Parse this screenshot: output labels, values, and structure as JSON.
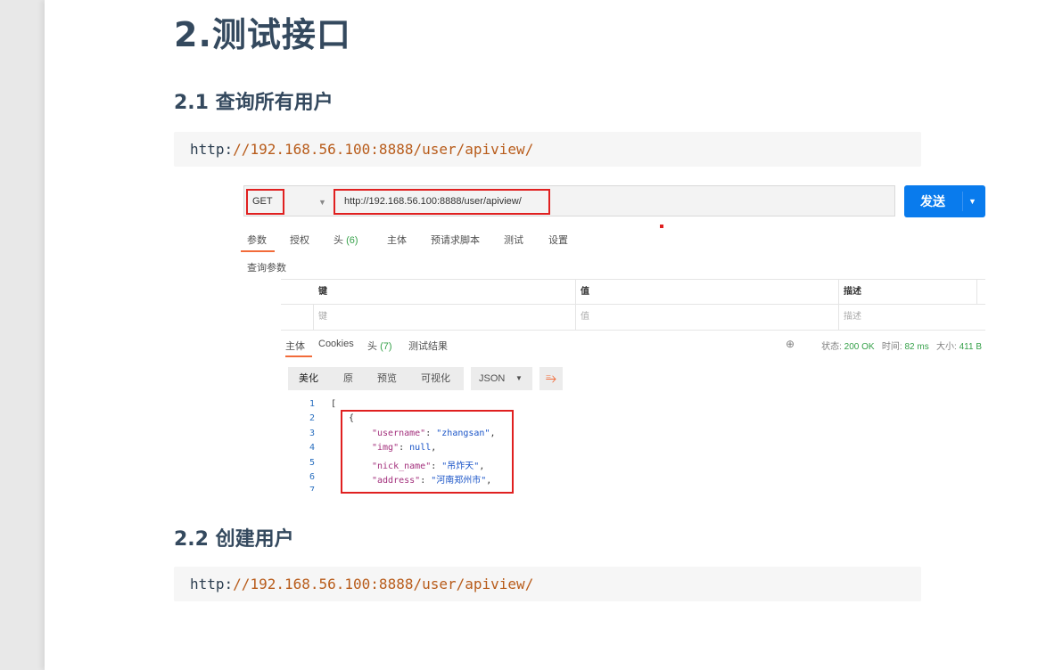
{
  "heading_main": "2.测试接口",
  "section1": {
    "title": "2.1 查询所有用户",
    "code_prefix": "http:",
    "code_rest": "//192.168.56.100:8888/user/apiview/"
  },
  "section2": {
    "title": "2.2 创建用户",
    "code_prefix": "http:",
    "code_rest": "//192.168.56.100:8888/user/apiview/"
  },
  "postman": {
    "method": "GET",
    "url": "http://192.168.56.100:8888/user/apiview/",
    "send_label": "发送",
    "request_tabs": [
      {
        "label": "参数"
      },
      {
        "label": "授权"
      },
      {
        "label": "头",
        "count": "(6)"
      },
      {
        "label": "主体"
      },
      {
        "label": "预请求脚本"
      },
      {
        "label": "测试"
      },
      {
        "label": "设置"
      }
    ],
    "query_params_label": "查询参数",
    "params_headers": [
      "键",
      "值",
      "描述"
    ],
    "params_placeholders": [
      "键",
      "值",
      "描述"
    ],
    "response_tabs": [
      {
        "label": "主体"
      },
      {
        "label": "Cookies"
      },
      {
        "label": "头",
        "count": "(7)"
      },
      {
        "label": "测试结果"
      }
    ],
    "status": {
      "status_label": "状态:",
      "status_value": "200 OK",
      "time_label": "时间:",
      "time_value": "82 ms",
      "size_label": "大小:",
      "size_value": "411 B"
    },
    "format_buttons": [
      "美化",
      "原",
      "预览",
      "可视化"
    ],
    "format_select": "JSON",
    "code_lines": {
      "line_numbers": [
        "1",
        "2",
        "3",
        "4",
        "5",
        "6",
        "7"
      ],
      "l1": "[",
      "l2": "{",
      "l3_key": "\"username\"",
      "l3_val": "\"zhangsan\"",
      "l4_key": "\"img\"",
      "l4_val": "null",
      "l5_key": "\"nick_name\"",
      "l5_val": "\"吊炸天\"",
      "l6_key": "\"address\"",
      "l6_val": "\"河南郑州市\""
    }
  }
}
